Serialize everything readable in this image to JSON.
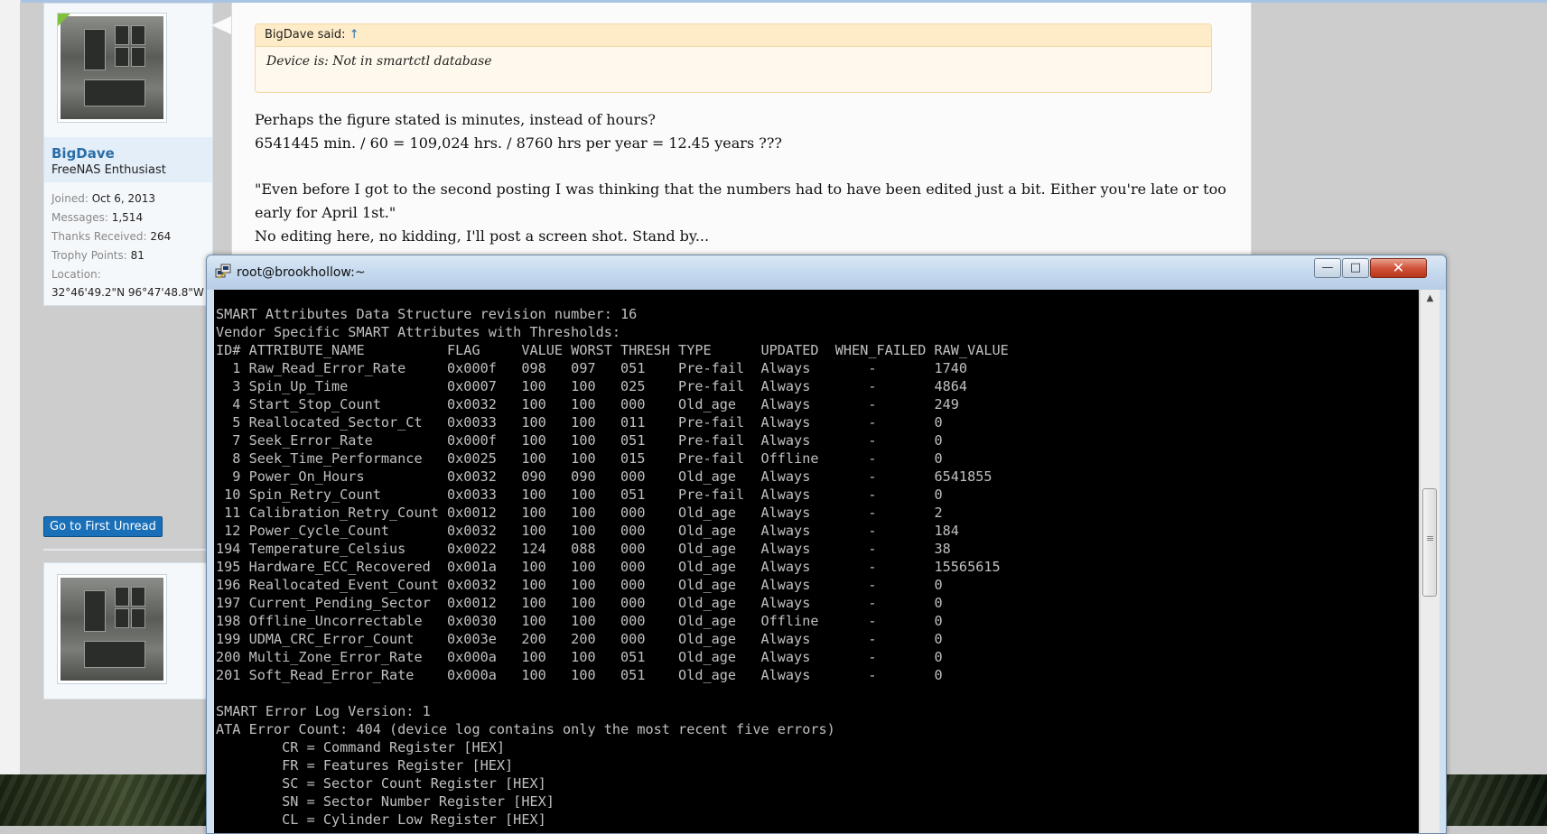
{
  "forum": {
    "author": {
      "name": "BigDave",
      "title": "FreeNAS Enthusiast",
      "extras": [
        {
          "label": "Joined:",
          "value": "Oct 6, 2013"
        },
        {
          "label": "Messages:",
          "value": "1,514"
        },
        {
          "label": "Thanks Received:",
          "value": "264"
        },
        {
          "label": "Trophy Points:",
          "value": "81"
        },
        {
          "label": "Location:",
          "value": ""
        }
      ],
      "location": "32°46'49.2\"N 96°47'48.8\"W"
    },
    "first_unread_label": "Go to First Unread",
    "quote": {
      "header": "BigDave said:",
      "up_arrow": "↑",
      "body": "Device is: Not in smartctl database"
    },
    "post_lines": [
      "Perhaps the figure stated is minutes, instead of hours?",
      "6541445 min. / 60 = 109,024 hrs. / 8760 hrs per year = 12.45 years ???",
      "\"Even before I got to the second posting I was thinking that the numbers had to have been edited just a bit. Either you're late or too",
      "early for April 1st.\"",
      "No editing here, no kidding, I'll post a screen shot. Stand by..."
    ]
  },
  "terminal": {
    "title": "root@brookhollow:~",
    "buttons": {
      "minimize": "—",
      "maximize": "□",
      "close": "✕"
    },
    "icon": "putty-icon",
    "text": "SMART Attributes Data Structure revision number: 16\nVendor Specific SMART Attributes with Thresholds:\nID# ATTRIBUTE_NAME          FLAG     VALUE WORST THRESH TYPE      UPDATED  WHEN_FAILED RAW_VALUE\n  1 Raw_Read_Error_Rate     0x000f   098   097   051    Pre-fail  Always       -       1740\n  3 Spin_Up_Time            0x0007   100   100   025    Pre-fail  Always       -       4864\n  4 Start_Stop_Count        0x0032   100   100   000    Old_age   Always       -       249\n  5 Reallocated_Sector_Ct   0x0033   100   100   011    Pre-fail  Always       -       0\n  7 Seek_Error_Rate         0x000f   100   100   051    Pre-fail  Always       -       0\n  8 Seek_Time_Performance   0x0025   100   100   015    Pre-fail  Offline      -       0\n  9 Power_On_Hours          0x0032   090   090   000    Old_age   Always       -       6541855\n 10 Spin_Retry_Count        0x0033   100   100   051    Pre-fail  Always       -       0\n 11 Calibration_Retry_Count 0x0012   100   100   000    Old_age   Always       -       2\n 12 Power_Cycle_Count       0x0032   100   100   000    Old_age   Always       -       184\n194 Temperature_Celsius     0x0022   124   088   000    Old_age   Always       -       38\n195 Hardware_ECC_Recovered  0x001a   100   100   000    Old_age   Always       -       15565615\n196 Reallocated_Event_Count 0x0032   100   100   000    Old_age   Always       -       0\n197 Current_Pending_Sector  0x0012   100   100   000    Old_age   Always       -       0\n198 Offline_Uncorrectable   0x0030   100   100   000    Old_age   Offline      -       0\n199 UDMA_CRC_Error_Count    0x003e   200   200   000    Old_age   Always       -       0\n200 Multi_Zone_Error_Rate   0x000a   100   100   051    Old_age   Always       -       0\n201 Soft_Read_Error_Rate    0x000a   100   100   051    Old_age   Always       -       0\n\nSMART Error Log Version: 1\nATA Error Count: 404 (device log contains only the most recent five errors)\n        CR = Command Register [HEX]\n        FR = Features Register [HEX]\n        SC = Sector Count Register [HEX]\n        SN = Sector Number Register [HEX]\n        CL = Cylinder Low Register [HEX]"
  },
  "colors": {
    "username": "#2a6ea8",
    "button": "#1a70b8",
    "quote_bg": "#fff8ec",
    "terminal_bg": "#000000",
    "terminal_fg": "#c0c0c0"
  }
}
